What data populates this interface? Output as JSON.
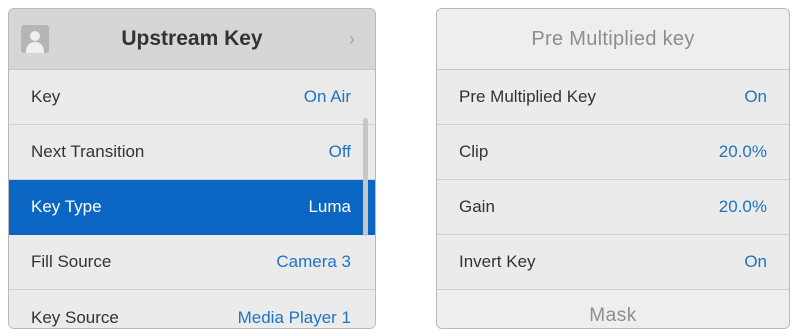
{
  "left_panel": {
    "title": "Upstream Key",
    "header_icon": "avatar-icon",
    "nav_icon": "chevron-right-icon",
    "chevron_glyph": "›",
    "rows": [
      {
        "label": "Key",
        "value": "On Air"
      },
      {
        "label": "Next Transition",
        "value": "Off"
      },
      {
        "label": "Key Type",
        "value": "Luma"
      },
      {
        "label": "Fill Source",
        "value": "Camera 3"
      },
      {
        "label": "Key Source",
        "value": "Media Player 1"
      }
    ],
    "selected_row": "Key Type"
  },
  "right_panel": {
    "title": "Pre Multiplied key",
    "rows": [
      {
        "label": "Pre Multiplied Key",
        "value": "On"
      },
      {
        "label": "Clip",
        "value": "20.0%"
      },
      {
        "label": "Gain",
        "value": "20.0%"
      },
      {
        "label": "Invert Key",
        "value": "On"
      }
    ],
    "footer": "Mask"
  },
  "colors": {
    "accent": "#0a66c2",
    "value_text": "#1f73c5",
    "panel_bg": "#ebebeb",
    "header_bg": "#d6d6d6"
  }
}
